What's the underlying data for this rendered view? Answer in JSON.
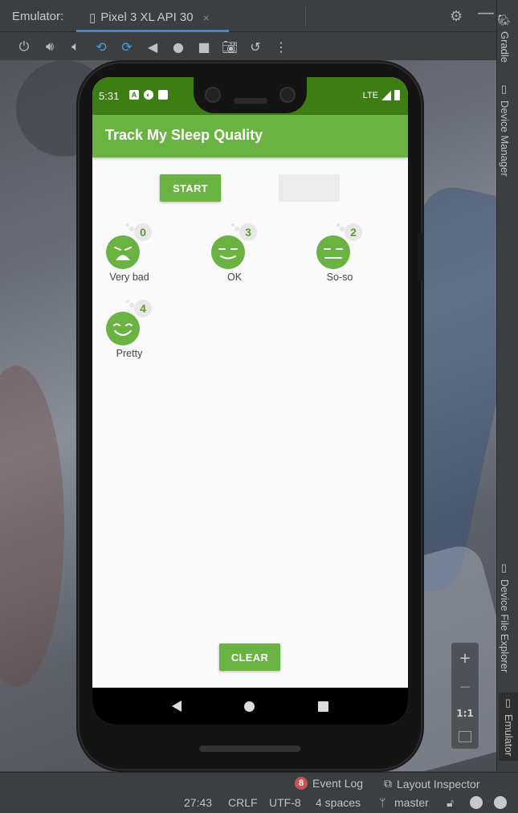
{
  "ide": {
    "panel_label": "Emulator:",
    "device_tab": "Pixel 3 XL API 30",
    "tab_close": "×",
    "toolbar_icons": [
      "power-icon",
      "volume-up-icon",
      "volume-down-icon",
      "rotate-left-icon",
      "rotate-right-icon",
      "back-icon",
      "home-icon",
      "overview-icon",
      "screenshot-icon",
      "snapshot-icon",
      "more-icon"
    ],
    "side_tools": {
      "gradle": "Gradle",
      "device_manager": "Device Manager",
      "device_file_explorer": "Device File Explorer",
      "emulator": "Emulator"
    },
    "zoom": {
      "plus": "+",
      "minus": "−",
      "one_to_one": "1:1"
    },
    "event_log": {
      "count": "8",
      "label": "Event Log"
    },
    "layout_inspector": "Layout Inspector",
    "status": {
      "position": "27:43",
      "line_ending": "CRLF",
      "encoding": "UTF-8",
      "indent": "4 spaces",
      "branch": "master"
    }
  },
  "phone": {
    "status_bar": {
      "time": "5:31",
      "network": "LTE"
    },
    "app_bar": {
      "title": "Track My Sleep Quality"
    },
    "buttons": {
      "start": "START",
      "stop": "",
      "clear": "CLEAR"
    },
    "nights": [
      {
        "count": "0",
        "label": "Very bad",
        "face": "very-bad"
      },
      {
        "count": "3",
        "label": "OK",
        "face": "ok"
      },
      {
        "count": "2",
        "label": "So-so",
        "face": "so-so"
      },
      {
        "count": "4",
        "label": "Pretty",
        "face": "pretty"
      }
    ]
  },
  "colors": {
    "status_bar": "#3c7e14",
    "primary": "#6ab343",
    "badge_text": "#5a9d36",
    "event_badge": "#c75450"
  }
}
